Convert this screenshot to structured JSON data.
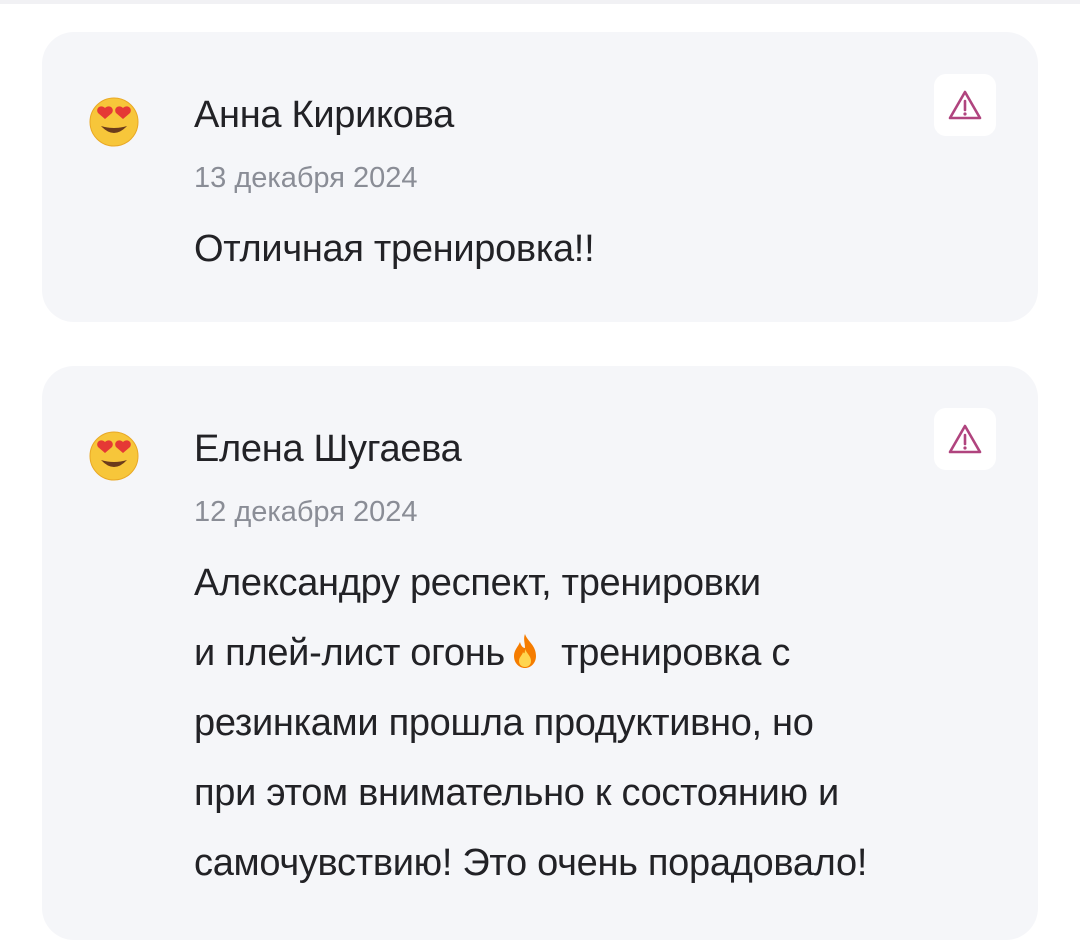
{
  "reviews": [
    {
      "author": "Анна Кирикова",
      "date": "13 декабря 2024",
      "text_lines": [
        "Отличная тренировка!!"
      ],
      "avatar_icon": "heart-eyes-emoji-icon",
      "report_icon": "warning-triangle-icon"
    },
    {
      "author": "Елена Шугаева",
      "date": "12 декабря 2024",
      "text_lines": [
        "Александру респект, тренировки",
        "и плей-лист огонь",
        " тренировка с",
        "резинками прошла продуктивно, но",
        "при этом внимательно к состоянию и",
        "самочувствию! Это очень порадовало!"
      ],
      "inline_icon": "fire-emoji-icon",
      "avatar_icon": "heart-eyes-emoji-icon",
      "report_icon": "warning-triangle-icon"
    }
  ],
  "colors": {
    "card_background": "#f5f6f9",
    "report_icon": "#b0447e",
    "text_primary": "#222226",
    "text_secondary": "#8a8d96"
  }
}
